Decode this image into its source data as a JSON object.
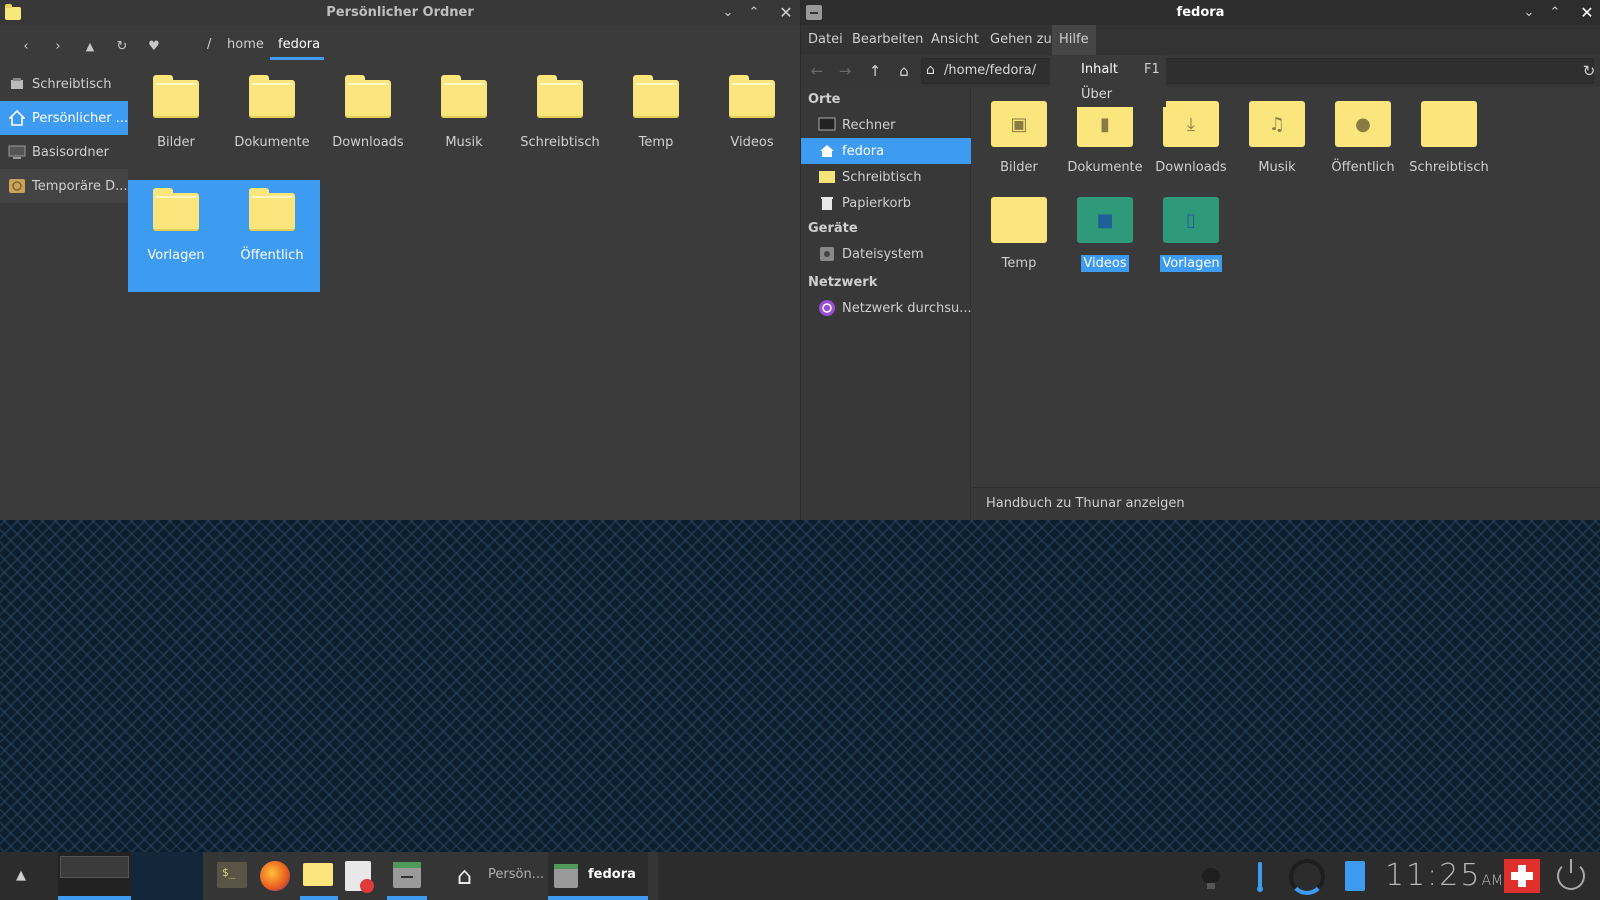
{
  "left_window": {
    "title": "Persönlicher Ordner",
    "breadcrumb": {
      "root": "/",
      "items": [
        "home",
        "fedora"
      ]
    },
    "sidebar": [
      {
        "label": "Schreibtisch",
        "icon": "desktop-icon",
        "state": "normal"
      },
      {
        "label": "Persönlicher ...",
        "icon": "home-icon",
        "state": "active"
      },
      {
        "label": "Basisordner",
        "icon": "computer-icon",
        "state": "normal"
      },
      {
        "label": "Temporäre D...",
        "icon": "clock-icon",
        "state": "hover"
      }
    ],
    "folders": [
      {
        "label": "Bilder",
        "selected": false
      },
      {
        "label": "Dokumente",
        "selected": false
      },
      {
        "label": "Downloads",
        "selected": false
      },
      {
        "label": "Musik",
        "selected": false
      },
      {
        "label": "Schreibtisch",
        "selected": false
      },
      {
        "label": "Temp",
        "selected": false
      },
      {
        "label": "Videos",
        "selected": false
      },
      {
        "label": "Vorlagen",
        "selected": true
      },
      {
        "label": "Öffentlich",
        "selected": true
      }
    ]
  },
  "right_window": {
    "title": "fedora",
    "menu": [
      "Datei",
      "Bearbeiten",
      "Ansicht",
      "Gehen zu",
      "Hilfe"
    ],
    "open_menu": "Hilfe",
    "help_menu": [
      {
        "label": "Inhalt",
        "accel": "F1"
      },
      {
        "label": "Über",
        "accel": ""
      }
    ],
    "location": "/home/fedora/",
    "sidebar": {
      "places_header": "Orte",
      "places": [
        {
          "label": "Rechner",
          "icon": "monitor-icon"
        },
        {
          "label": "fedora",
          "icon": "home-icon",
          "active": true
        },
        {
          "label": "Schreibtisch",
          "icon": "desktop-folder-icon"
        },
        {
          "label": "Papierkorb",
          "icon": "trash-icon"
        }
      ],
      "devices_header": "Geräte",
      "devices": [
        {
          "label": "Dateisystem",
          "icon": "drive-icon"
        }
      ],
      "network_header": "Netzwerk",
      "network": [
        {
          "label": "Netzwerk durchsu...",
          "icon": "globe-icon"
        }
      ]
    },
    "folders": [
      {
        "label": "Bilder",
        "emblem": "▣",
        "variant": "yellow",
        "selected": false
      },
      {
        "label": "Dokumente",
        "emblem": "▮",
        "variant": "yellow",
        "selected": false
      },
      {
        "label": "Downloads",
        "emblem": "⤓",
        "variant": "yellow",
        "selected": false
      },
      {
        "label": "Musik",
        "emblem": "♫",
        "variant": "yellow",
        "selected": false
      },
      {
        "label": "Öffentlich",
        "emblem": "●",
        "variant": "yellow",
        "selected": false
      },
      {
        "label": "Schreibtisch",
        "emblem": "",
        "variant": "yellow",
        "selected": false
      },
      {
        "label": "Temp",
        "emblem": "",
        "variant": "yellow",
        "selected": false
      },
      {
        "label": "Videos",
        "emblem": "■",
        "variant": "teal",
        "selected": true
      },
      {
        "label": "Vorlagen",
        "emblem": "▯",
        "variant": "teal",
        "selected": true
      }
    ],
    "status": "Handbuch zu Thunar anzeigen"
  },
  "taskbar": {
    "tasks": [
      {
        "label": "Persön...",
        "icon": "home-icon",
        "active": false
      },
      {
        "label": "fedora",
        "icon": "file-manager-icon",
        "active": true
      }
    ],
    "clock": {
      "time": "11:25",
      "meridiem": "AM"
    }
  },
  "colors": {
    "accent": "#3d9bf2",
    "folder_yellow": "#fbe67d",
    "folder_teal": "#2f9a7a",
    "panel": "#3b3b3b"
  }
}
